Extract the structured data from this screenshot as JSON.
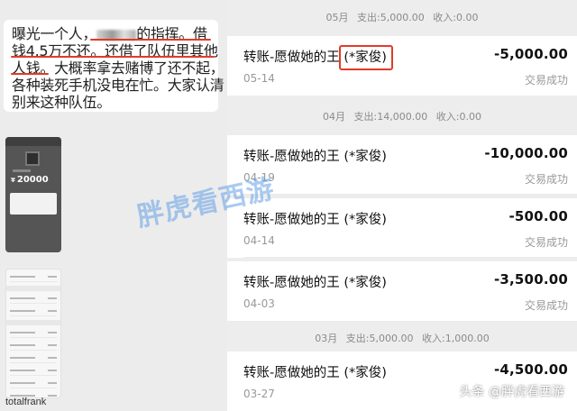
{
  "chat": {
    "lines": [
      [
        "曝光一个人，",
        "的指挥。借"
      ],
      "钱4.5万不还。还借了队伍里其他",
      "人钱。大概率拿去赌博了还不起，",
      "各种装死手机没电在忙。大家认清",
      "别来这种队伍。"
    ],
    "thumb_amount": "20000",
    "thumb_currency": "¥",
    "username": "totalfrank"
  },
  "ledger": {
    "months": [
      {
        "label": "05月",
        "out": "支出:5,000.00",
        "in": "收入:0.00"
      },
      {
        "label": "04月",
        "out": "支出:14,000.00",
        "in": "收入:0.00"
      },
      {
        "label": "03月",
        "out": "支出:5,000.00",
        "in": "收入:1,000.00"
      }
    ],
    "transactions": [
      {
        "name": "转账-愿做她的王 (*家俊)",
        "date": "05-14",
        "amount": "-5,000.00",
        "status": "交易成功"
      },
      {
        "name": "转账-愿做她的王 (*家俊)",
        "date": "04-19",
        "amount": "-10,000.00",
        "status": "交易成功"
      },
      {
        "name": "转账-愿做她的王 (*家俊)",
        "date": "04-14",
        "amount": "-500.00",
        "status": "交易成功"
      },
      {
        "name": "转账-愿做她的王 (*家俊)",
        "date": "04-03",
        "amount": "-3,500.00",
        "status": "交易成功"
      },
      {
        "name": "转账-愿做她的王 (*家俊)",
        "date": "03-27",
        "amount": "-4,500.00",
        "status": ""
      }
    ]
  },
  "watermark": "胖虎看西游",
  "credit": "头条 @胖虎看西游"
}
